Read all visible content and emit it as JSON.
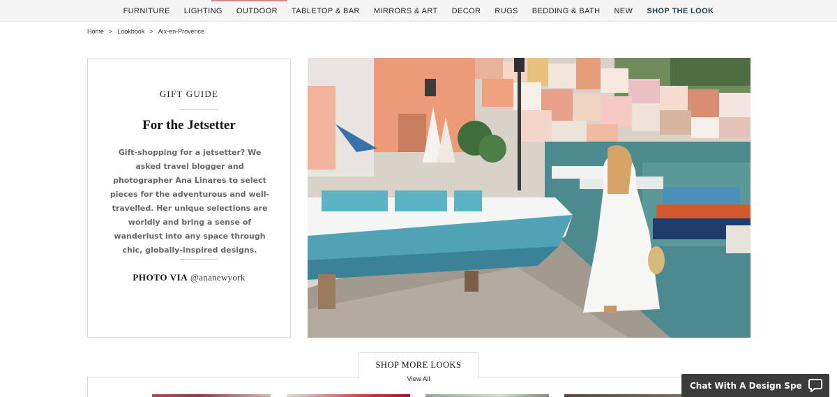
{
  "nav": {
    "items": [
      {
        "label": "FURNITURE"
      },
      {
        "label": "LIGHTING"
      },
      {
        "label": "OUTDOOR"
      },
      {
        "label": "TABLETOP & BAR"
      },
      {
        "label": "MIRRORS & ART"
      },
      {
        "label": "DECOR"
      },
      {
        "label": "RUGS"
      },
      {
        "label": "BEDDING & BATH"
      },
      {
        "label": "NEW"
      },
      {
        "label": "SHOP THE LOOK"
      }
    ],
    "active_index": 9,
    "accent_color": "#1d3d4f"
  },
  "breadcrumb": {
    "home": "Home",
    "lookbook": "Lookbook",
    "current": "Aix-en-Provence",
    "separator": ">"
  },
  "card": {
    "eyebrow": "GIFT GUIDE",
    "title": "For the Jetsetter",
    "description": "Gift-shopping for a jetsetter? We asked travel blogger and photographer Ana Linares to select pieces for the adventurous and well-travelled. Her unique selections are worldly and bring a sense of wanderlust into any space through chic, globally-inspired designs.",
    "credit_label": "PHOTO VIA",
    "credit_handle": "@ananewyork"
  },
  "hero": {
    "alt_icon": "harbor-photo"
  },
  "more_looks": {
    "label": "SHOP MORE LOOKS",
    "link": "View All"
  },
  "chat": {
    "label": "Chat With A Design Speci...",
    "icon": "chat-bubble-icon",
    "background": "#3b3b3b"
  }
}
